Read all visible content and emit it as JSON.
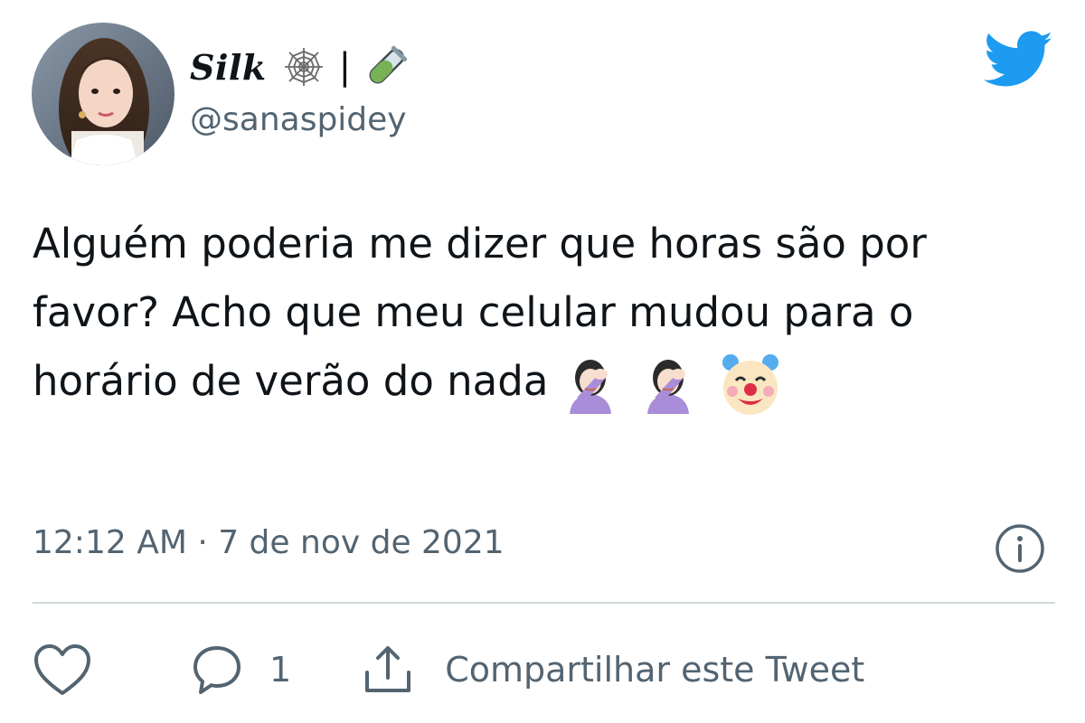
{
  "author": {
    "display_name": "Silk",
    "separator": "|",
    "name_icons": [
      "spider-web-icon",
      "test-tube-icon"
    ],
    "handle": "@sanaspidey",
    "avatar": "profile-photo"
  },
  "tweet": {
    "text": "Alguém poderia me dizer que horas são por favor? Acho que meu celular mudou para o horário de verão do nada",
    "emojis": [
      "facepalm-icon",
      "facepalm-icon",
      "clown-face-icon"
    ],
    "timestamp": "12:12 AM · 7 de nov de 2021"
  },
  "actions": {
    "like_label": "",
    "reply_count": "1",
    "share_label": "Compartilhar este Tweet"
  },
  "colors": {
    "twitter_blue": "#1d9bf0",
    "secondary_text": "#536471",
    "primary_text": "#0f1419",
    "divider": "#cfd9de"
  }
}
